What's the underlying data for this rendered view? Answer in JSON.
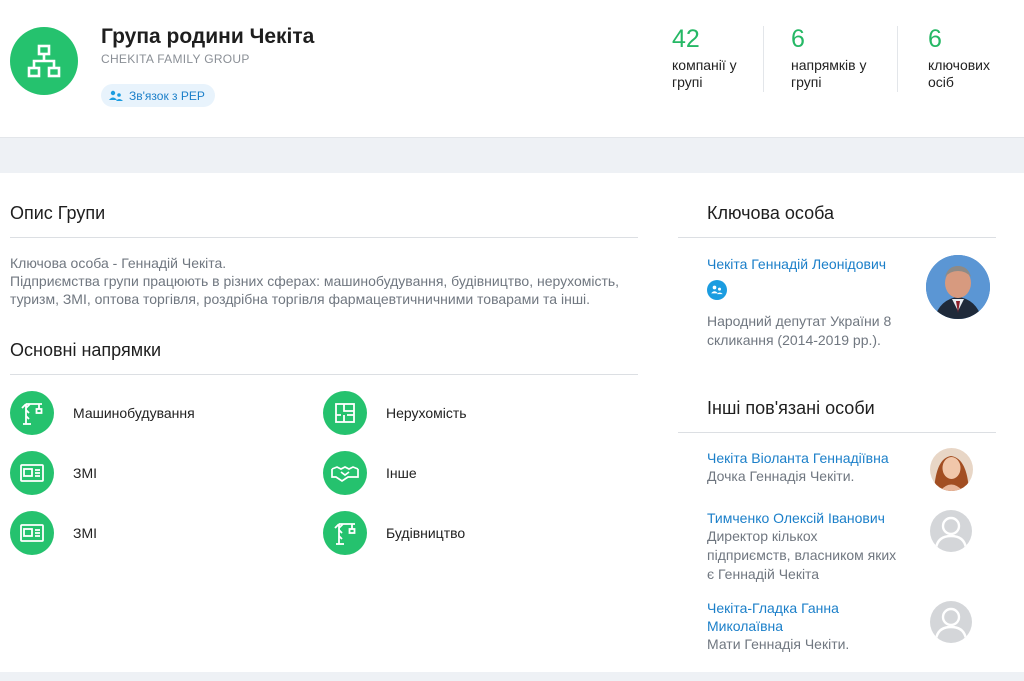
{
  "header": {
    "title": "Група родини Чекіта",
    "subtitle": "CHEKITA FAMILY GROUP",
    "pep_link": "Зв'язок з PEP",
    "logo_icon": "hierarchy-icon",
    "accent": "#25c26e"
  },
  "stats": [
    {
      "value": "42",
      "label_line1": "компанії у",
      "label_line2": "групі"
    },
    {
      "value": "6",
      "label_line1": "напрямків у",
      "label_line2": "групі"
    },
    {
      "value": "6",
      "label_line1": "ключових",
      "label_line2": "осіб"
    }
  ],
  "description": {
    "title": "Опис Групи",
    "line1": "Ключова особа - Геннадій Чекіта.",
    "line2": "Підприємства групи працюють в різних сферах: машинобудування, будівництво, нерухомість, туризм, ЗМІ, оптова торгівля, роздрібна торгівля фармацевтичничними товарами та інші."
  },
  "directions": {
    "title": "Основні напрямки",
    "items": [
      {
        "label": "Машинобудування",
        "icon": "crane-icon"
      },
      {
        "label": "Нерухомість",
        "icon": "floorplan-icon"
      },
      {
        "label": "ЗМІ",
        "icon": "media-icon"
      },
      {
        "label": "Інше",
        "icon": "handshake-icon"
      },
      {
        "label": "ЗМІ",
        "icon": "media-icon"
      },
      {
        "label": "Будівництво",
        "icon": "crane-icon"
      }
    ]
  },
  "key_person": {
    "title": "Ключова особа",
    "name": "Чекіта Геннадій Леонідович",
    "role_line1": "Народний депутат України 8",
    "role_line2": "скликання (2014-2019 рр.)."
  },
  "related": {
    "title": "Інші пов'язані особи",
    "people": [
      {
        "name_line1": "Чекіта Віоланта Геннадіївна",
        "role_lines": [
          "Дочка Геннадія Чекіти."
        ]
      },
      {
        "name_line1": "Тимченко Олексій Іванович",
        "role_lines": [
          "Директор кількох",
          "підприємств, власником яких",
          "є Геннадій Чекіта"
        ]
      },
      {
        "name_line1": "Чекіта-Гладка Ганна",
        "name_line2": "Миколаївна",
        "role_lines": [
          "Мати Геннадія Чекіти."
        ]
      }
    ]
  }
}
